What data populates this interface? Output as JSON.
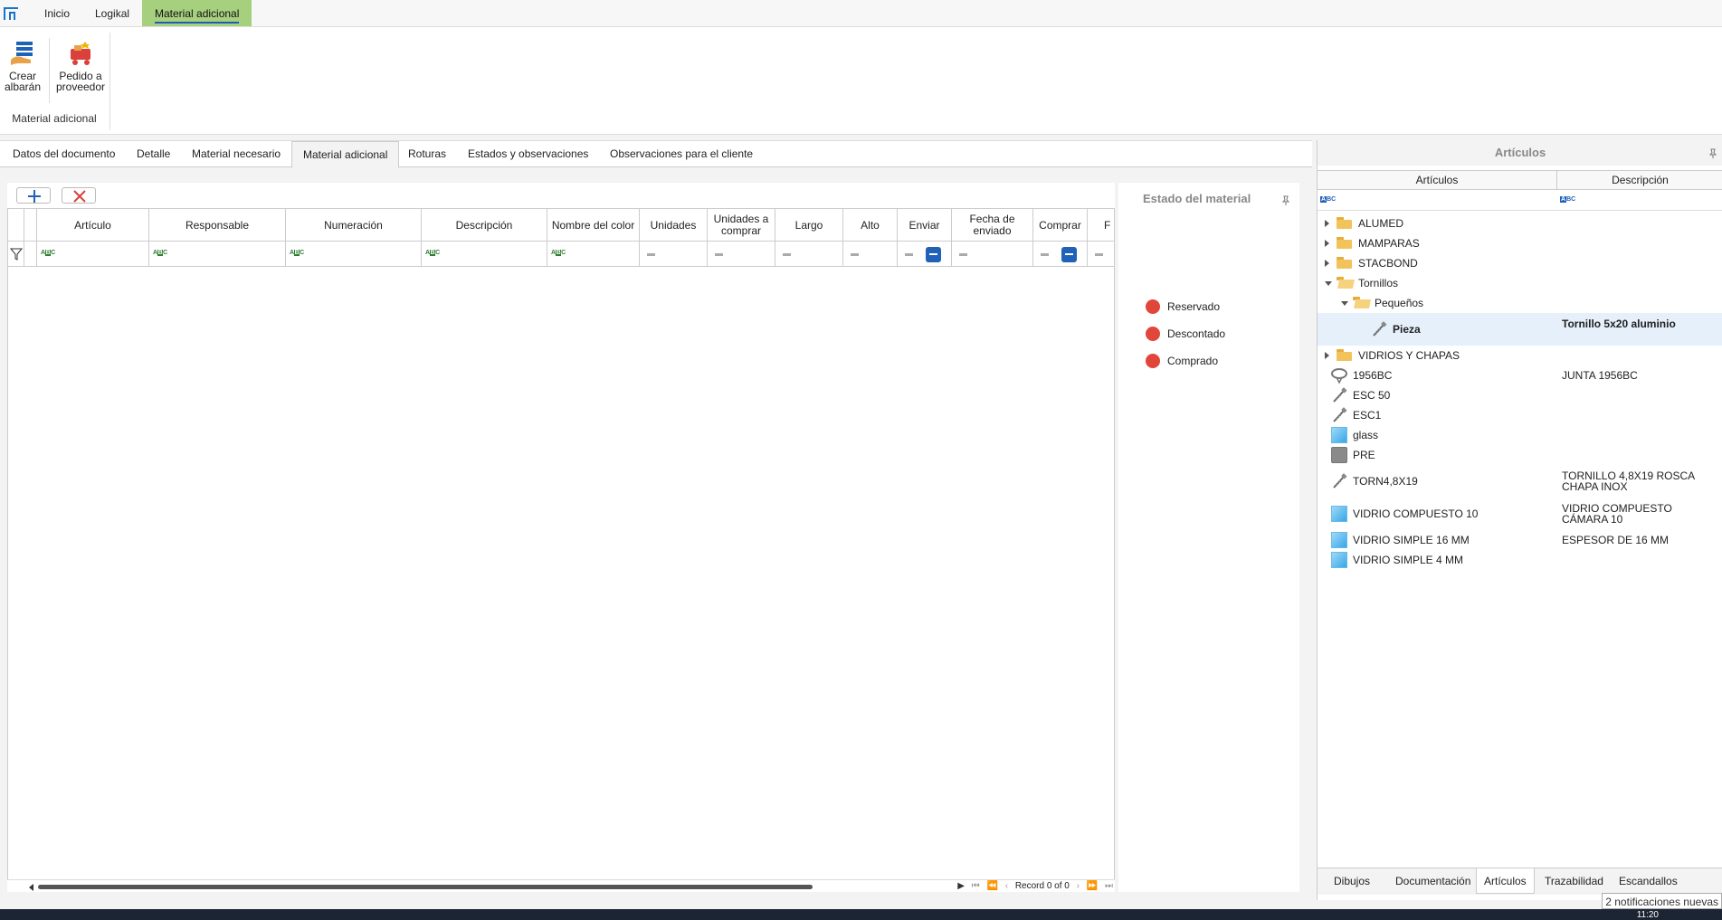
{
  "menubar": {
    "items": [
      "Inicio",
      "Logikal",
      "Material adicional"
    ],
    "active": "Material adicional"
  },
  "ribbon": {
    "buttons": [
      {
        "line1": "Crear",
        "line2": "albarán",
        "icon": "create-delivery-note-icon"
      },
      {
        "line1": "Pedido a",
        "line2": "proveedor",
        "icon": "supplier-order-icon"
      }
    ],
    "group_label": "Material adicional"
  },
  "doc_tabs": [
    "Datos del documento",
    "Detalle",
    "Material necesario",
    "Material adicional",
    "Roturas",
    "Estados y observaciones",
    "Observaciones para el cliente"
  ],
  "doc_tabs_active": "Material adicional",
  "grid": {
    "columns": [
      {
        "label": "Artículo",
        "filter": "text"
      },
      {
        "label": "Responsable",
        "filter": "text"
      },
      {
        "label": "Numeración",
        "filter": "text"
      },
      {
        "label": "Descripción",
        "filter": "text"
      },
      {
        "label": "Nombre del color",
        "filter": "text"
      },
      {
        "label": "Unidades",
        "filter": "number"
      },
      {
        "label": "Unidades a comprar",
        "filter": "number"
      },
      {
        "label": "Largo",
        "filter": "number"
      },
      {
        "label": "Alto",
        "filter": "number"
      },
      {
        "label": "Enviar",
        "filter": "check"
      },
      {
        "label": "Fecha de enviado",
        "filter": "number"
      },
      {
        "label": "Comprar",
        "filter": "check"
      },
      {
        "label": "F",
        "filter": "number"
      }
    ],
    "rows": [],
    "pager_text": "Record 0 of 0"
  },
  "estado": {
    "title": "Estado del material",
    "legend": [
      {
        "label": "Reservado",
        "color": "#e0463a"
      },
      {
        "label": "Descontado",
        "color": "#e0463a"
      },
      {
        "label": "Comprado",
        "color": "#e0463a"
      }
    ]
  },
  "articulos": {
    "title": "Artículos",
    "columns": [
      "Artículos",
      "Descripción"
    ],
    "tree": [
      {
        "label": "ALUMED",
        "desc": "",
        "level": 0,
        "icon": "folder-icon",
        "expand": "collapsed"
      },
      {
        "label": "MAMPARAS",
        "desc": "",
        "level": 0,
        "icon": "folder-icon",
        "expand": "collapsed"
      },
      {
        "label": "STACBOND",
        "desc": "",
        "level": 0,
        "icon": "folder-icon",
        "expand": "collapsed"
      },
      {
        "label": "Tornillos",
        "desc": "",
        "level": 0,
        "icon": "folder-open-icon",
        "expand": "expanded"
      },
      {
        "label": "Pequeños",
        "desc": "",
        "level": 1,
        "icon": "folder-open-icon",
        "expand": "expanded"
      },
      {
        "label": "Pieza",
        "desc": "Tornillo 5x20 aluminio",
        "level": 2,
        "icon": "screw-icon",
        "expand": "none",
        "selected": true
      },
      {
        "label": "VIDRIOS Y CHAPAS",
        "desc": "",
        "level": 0,
        "icon": "folder-icon",
        "expand": "collapsed"
      },
      {
        "label": "1956BC",
        "desc": "JUNTA 1956BC",
        "level": 0,
        "icon": "gasket-icon",
        "expand": "none"
      },
      {
        "label": "ESC 50",
        "desc": "",
        "level": 0,
        "icon": "screw-icon",
        "expand": "none"
      },
      {
        "label": "ESC1",
        "desc": "",
        "level": 0,
        "icon": "screw-icon",
        "expand": "none"
      },
      {
        "label": "glass",
        "desc": "",
        "level": 0,
        "icon": "glass-icon",
        "expand": "none"
      },
      {
        "label": "PRE",
        "desc": "",
        "level": 0,
        "icon": "profile-icon",
        "expand": "none"
      },
      {
        "label": "TORN4,8X19",
        "desc": "TORNILLO 4,8X19 ROSCA CHAPA INOX",
        "level": 0,
        "icon": "screw-icon",
        "expand": "none"
      },
      {
        "label": "VIDRIO COMPUESTO 10",
        "desc": "VIDRIO COMPUESTO CÁMARA 10",
        "level": 0,
        "icon": "glass-icon",
        "expand": "none"
      },
      {
        "label": "VIDRIO SIMPLE 16 MM",
        "desc": "ESPESOR DE 16 MM",
        "level": 0,
        "icon": "glass-icon",
        "expand": "none"
      },
      {
        "label": "VIDRIO SIMPLE 4 MM",
        "desc": "",
        "level": 0,
        "icon": "glass-icon",
        "expand": "none"
      }
    ],
    "bottom_tabs": [
      "Dibujos",
      "Documentación",
      "Artículos",
      "Trazabilidad",
      "Escandallos"
    ],
    "bottom_tab_active": "Artículos"
  },
  "notification": "2 notificaciones nuevas",
  "clock": "11:20"
}
